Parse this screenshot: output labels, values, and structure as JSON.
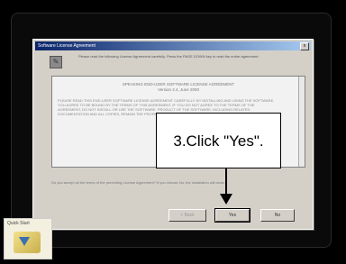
{
  "dialog": {
    "title": "Software License Agreement",
    "close_glyph": "x",
    "intro": "Please read the following License Agreement carefully. Press the PAGE DOWN key to read the entire agreement.",
    "eula_title": "SPEAKING END-USER SOFTWARE LICENSE AGREEMENT\nVersion 2.4, June 2000",
    "eula_body": "PLEASE READ THIS END-USER SOFTWARE LICENSE AGREEMENT CAREFULLY. BY INSTALLING AND USING THE SOFTWARE, YOU AGREE TO BE BOUND BY THE TERMS OF THIS AGREEMENT. IF YOU DO NOT AGREE TO THE TERMS OF THE AGREEMENT, DO NOT INSTALL OR USE THE SOFTWARE. PRODUCT OF THE SOFTWARE, INCLUDING RELATED DOCUMENTATION AND ALL COPIES, REMAIN THE PROPERTY OF THE SOFTWARE PUBLISHER.",
    "question": "Do you accept all the terms of the preceding License Agreement? If you choose No, the installation will close.",
    "buttons": {
      "back": "< Back",
      "yes": "Yes",
      "no": "No"
    }
  },
  "callout": {
    "text": "3.Click \"Yes\"."
  },
  "logo": {
    "text": "Quick Start"
  }
}
